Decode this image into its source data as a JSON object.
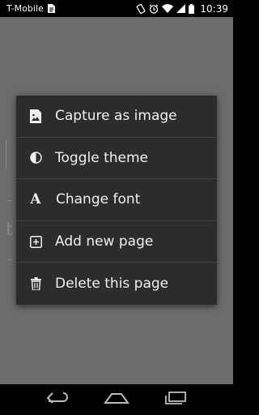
{
  "status_bar": {
    "carrier": "T-Mobile",
    "time": "10:39",
    "icons": [
      "document-icon",
      "rotate-icon",
      "alarm-icon",
      "wifi-icon",
      "signal-icon",
      "battery-icon"
    ]
  },
  "background": {
    "ghost_glyph": "t"
  },
  "menu": {
    "items": [
      {
        "label": "Capture as image",
        "icon": "image-icon"
      },
      {
        "label": "Toggle theme",
        "icon": "contrast-icon"
      },
      {
        "label": "Change font",
        "icon": "font-icon",
        "glyph": "A"
      },
      {
        "label": "Add new page",
        "icon": "add-box-icon"
      },
      {
        "label": "Delete this page",
        "icon": "trash-icon"
      }
    ]
  },
  "nav_bar": {
    "buttons": [
      "back",
      "home",
      "recents"
    ]
  }
}
